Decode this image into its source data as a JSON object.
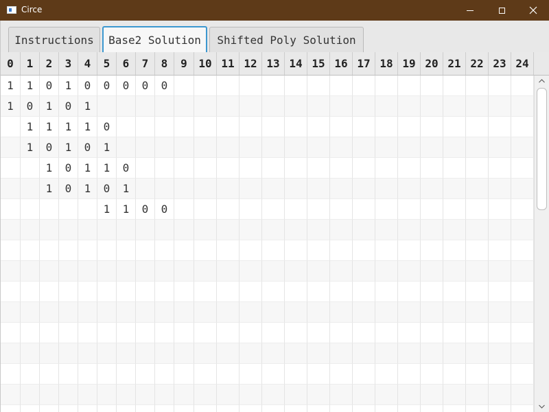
{
  "window": {
    "title": "Circe"
  },
  "tabs": [
    {
      "label": "Instructions",
      "active": false
    },
    {
      "label": "Base2 Solution",
      "active": true
    },
    {
      "label": "Shifted Poly Solution",
      "active": false
    }
  ],
  "table": {
    "columns": [
      "0",
      "1",
      "2",
      "3",
      "4",
      "5",
      "6",
      "7",
      "8",
      "9",
      "10",
      "11",
      "12",
      "13",
      "14",
      "15",
      "16",
      "17",
      "18",
      "19",
      "20",
      "21",
      "22",
      "23",
      "24"
    ],
    "rows": [
      [
        "1",
        "1",
        "0",
        "1",
        "0",
        "0",
        "0",
        "0",
        "0",
        "",
        "",
        "",
        "",
        "",
        "",
        "",
        "",
        "",
        "",
        "",
        "",
        "",
        "",
        "",
        ""
      ],
      [
        "1",
        "0",
        "1",
        "0",
        "1",
        "",
        "",
        "",
        "",
        "",
        "",
        "",
        "",
        "",
        "",
        "",
        "",
        "",
        "",
        "",
        "",
        "",
        "",
        "",
        ""
      ],
      [
        "",
        "1",
        "1",
        "1",
        "1",
        "0",
        "",
        "",
        "",
        "",
        "",
        "",
        "",
        "",
        "",
        "",
        "",
        "",
        "",
        "",
        "",
        "",
        "",
        "",
        ""
      ],
      [
        "",
        "1",
        "0",
        "1",
        "0",
        "1",
        "",
        "",
        "",
        "",
        "",
        "",
        "",
        "",
        "",
        "",
        "",
        "",
        "",
        "",
        "",
        "",
        "",
        "",
        ""
      ],
      [
        "",
        "",
        "1",
        "0",
        "1",
        "1",
        "0",
        "",
        "",
        "",
        "",
        "",
        "",
        "",
        "",
        "",
        "",
        "",
        "",
        "",
        "",
        "",
        "",
        "",
        ""
      ],
      [
        "",
        "",
        "1",
        "0",
        "1",
        "0",
        "1",
        "",
        "",
        "",
        "",
        "",
        "",
        "",
        "",
        "",
        "",
        "",
        "",
        "",
        "",
        "",
        "",
        "",
        ""
      ],
      [
        "",
        "",
        "",
        "",
        "",
        "1",
        "1",
        "0",
        "0",
        "",
        "",
        "",
        "",
        "",
        "",
        "",
        "",
        "",
        "",
        "",
        "",
        "",
        "",
        "",
        ""
      ],
      [
        "",
        "",
        "",
        "",
        "",
        "",
        "",
        "",
        "",
        "",
        "",
        "",
        "",
        "",
        "",
        "",
        "",
        "",
        "",
        "",
        "",
        "",
        "",
        "",
        ""
      ],
      [
        "",
        "",
        "",
        "",
        "",
        "",
        "",
        "",
        "",
        "",
        "",
        "",
        "",
        "",
        "",
        "",
        "",
        "",
        "",
        "",
        "",
        "",
        "",
        "",
        ""
      ],
      [
        "",
        "",
        "",
        "",
        "",
        "",
        "",
        "",
        "",
        "",
        "",
        "",
        "",
        "",
        "",
        "",
        "",
        "",
        "",
        "",
        "",
        "",
        "",
        "",
        ""
      ],
      [
        "",
        "",
        "",
        "",
        "",
        "",
        "",
        "",
        "",
        "",
        "",
        "",
        "",
        "",
        "",
        "",
        "",
        "",
        "",
        "",
        "",
        "",
        "",
        "",
        ""
      ],
      [
        "",
        "",
        "",
        "",
        "",
        "",
        "",
        "",
        "",
        "",
        "",
        "",
        "",
        "",
        "",
        "",
        "",
        "",
        "",
        "",
        "",
        "",
        "",
        "",
        ""
      ],
      [
        "",
        "",
        "",
        "",
        "",
        "",
        "",
        "",
        "",
        "",
        "",
        "",
        "",
        "",
        "",
        "",
        "",
        "",
        "",
        "",
        "",
        "",
        "",
        "",
        ""
      ],
      [
        "",
        "",
        "",
        "",
        "",
        "",
        "",
        "",
        "",
        "",
        "",
        "",
        "",
        "",
        "",
        "",
        "",
        "",
        "",
        "",
        "",
        "",
        "",
        "",
        ""
      ],
      [
        "",
        "",
        "",
        "",
        "",
        "",
        "",
        "",
        "",
        "",
        "",
        "",
        "",
        "",
        "",
        "",
        "",
        "",
        "",
        "",
        "",
        "",
        "",
        "",
        ""
      ],
      [
        "",
        "",
        "",
        "",
        "",
        "",
        "",
        "",
        "",
        "",
        "",
        "",
        "",
        "",
        "",
        "",
        "",
        "",
        "",
        "",
        "",
        "",
        "",
        "",
        ""
      ],
      [
        "",
        "",
        "",
        "",
        "",
        "",
        "",
        "",
        "",
        "",
        "",
        "",
        "",
        "",
        "",
        "",
        "",
        "",
        "",
        "",
        "",
        "",
        "",
        "",
        ""
      ]
    ]
  },
  "icons": {
    "app": "app-window-icon",
    "minimize": "minimize-icon",
    "maximize": "maximize-icon",
    "close": "close-icon",
    "scroll_up": "chevron-up-icon",
    "scroll_down": "chevron-down-icon"
  },
  "colors": {
    "titlebar": "#5e3a18",
    "active_tab_border": "#3c98d0",
    "header_bg": "#e9e9e9"
  }
}
